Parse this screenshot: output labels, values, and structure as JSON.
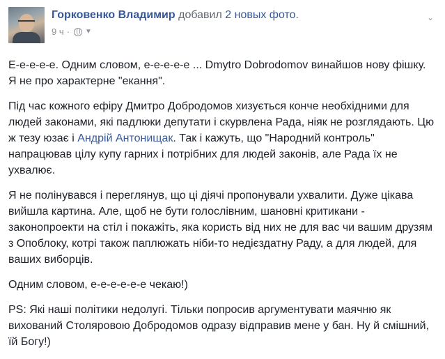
{
  "post": {
    "author": "Горковенко Владимир",
    "action_prefix": "добавил",
    "action_link": "2 новых фото",
    "action_suffix": ".",
    "time": "9 ч",
    "privacy_icon": "globe-icon",
    "menu_icon": "chevron-down-icon",
    "paragraphs": [
      {
        "text": "Е-е-е-е-е. Одним словом, е-е-е-е-е ... Dmytro Dobrodomov винайшов нову фішку. Я не про характерне \"екання\"."
      },
      {
        "before": "Під час кожного ефіру Дмитро Добродомов хизується конче необхідними для людей законами, які падлюки депутати і скурвлена Рада, ніяк не розглядають. Цю ж тезу юзає і ",
        "mention": "Андрій Антонищак",
        "after": ". Так і кажуть, що \"Народний контроль\" напрацював цілу купу гарних і потрібних для людей законів, але Рада їх не ухвалює."
      },
      {
        "text": "Я не полінувався і переглянув, що ці діячі пропонували ухвалити. Дуже цікава вийшла картина. Але, щоб не бути голослівним, шановні критикани - законопроекти на стіл і покажіть, яка користь від них не для вас чи вашим друзям з Опоблоку, котрі також паплюжать ніби-то недієздатну Раду, а для людей, для ваших виборців."
      },
      {
        "text": "Одним словом, е-е-е-е-е-е чекаю!)"
      },
      {
        "text": "PS: Які наші політики недолугі. Тільки попросив аргументувати маячню як вихований Столяровою Добродомов одразу відправив мене у бан. Ну й смішний, їй Богу!)"
      }
    ]
  },
  "colors": {
    "link": "#365899",
    "text": "#1d2129",
    "meta": "#90949c",
    "action": "#616770"
  }
}
